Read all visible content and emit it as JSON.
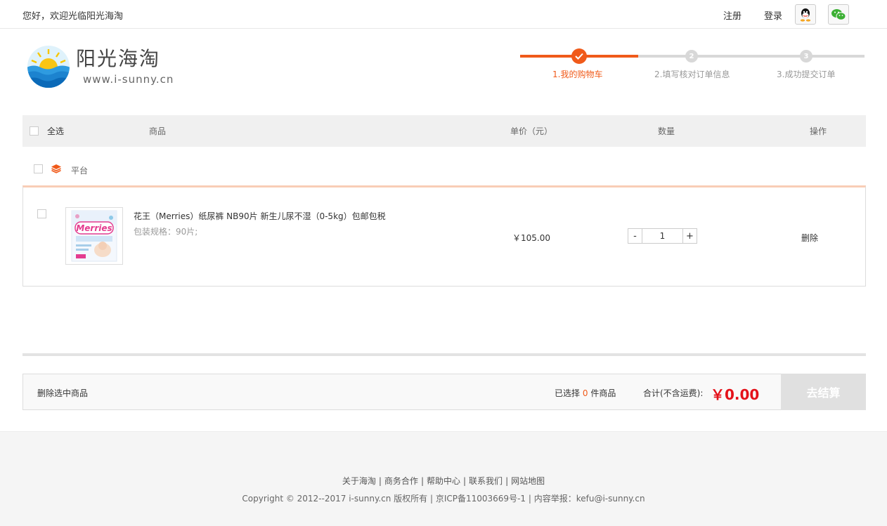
{
  "topbar": {
    "welcome": "您好，欢迎光临阳光海淘",
    "register": "注册",
    "login": "登录"
  },
  "logo": {
    "name": "阳光海淘",
    "url": "www.i-sunny.cn"
  },
  "steps": [
    {
      "label": "1.我的购物车",
      "active": true
    },
    {
      "label": "2.填写核对订单信息",
      "number": "2",
      "active": false
    },
    {
      "label": "3.成功提交订单",
      "number": "3",
      "active": false
    }
  ],
  "cart_header": {
    "select_all": "全选",
    "product": "商品",
    "unit_price": "单价（元）",
    "quantity": "数量",
    "action": "操作"
  },
  "store": {
    "name": "平台"
  },
  "item": {
    "title": "花王（Merries）纸尿裤 NB90片 新生儿尿不湿（0-5kg）包邮包税",
    "spec": "包装规格：90片;",
    "price": "￥105.00",
    "quantity": "1",
    "minus": "-",
    "plus": "+",
    "delete": "删除",
    "brand_text": "Merries"
  },
  "summary": {
    "delete_selected": "删除选中商品",
    "selected_prefix": "已选择",
    "selected_count": "0",
    "selected_suffix": "件商品",
    "total_label": "合计(不含运费):",
    "total_value": "￥0.00",
    "checkout": "去结算"
  },
  "footer": {
    "links": [
      "关于海淘",
      "商务合作",
      "帮助中心",
      "联系我们",
      "网站地图"
    ],
    "separator": "|",
    "copyright": "Copyright © 2012--2017 i-sunny.cn 版权所有 | 京ICP备11003669号-1 | 内容举报：kefu@i-sunny.cn"
  },
  "colors": {
    "accent": "#f05a1a",
    "price_red": "#e4121a",
    "header_bg": "#f0f0f0",
    "footer_bg": "#f5f5f5"
  }
}
